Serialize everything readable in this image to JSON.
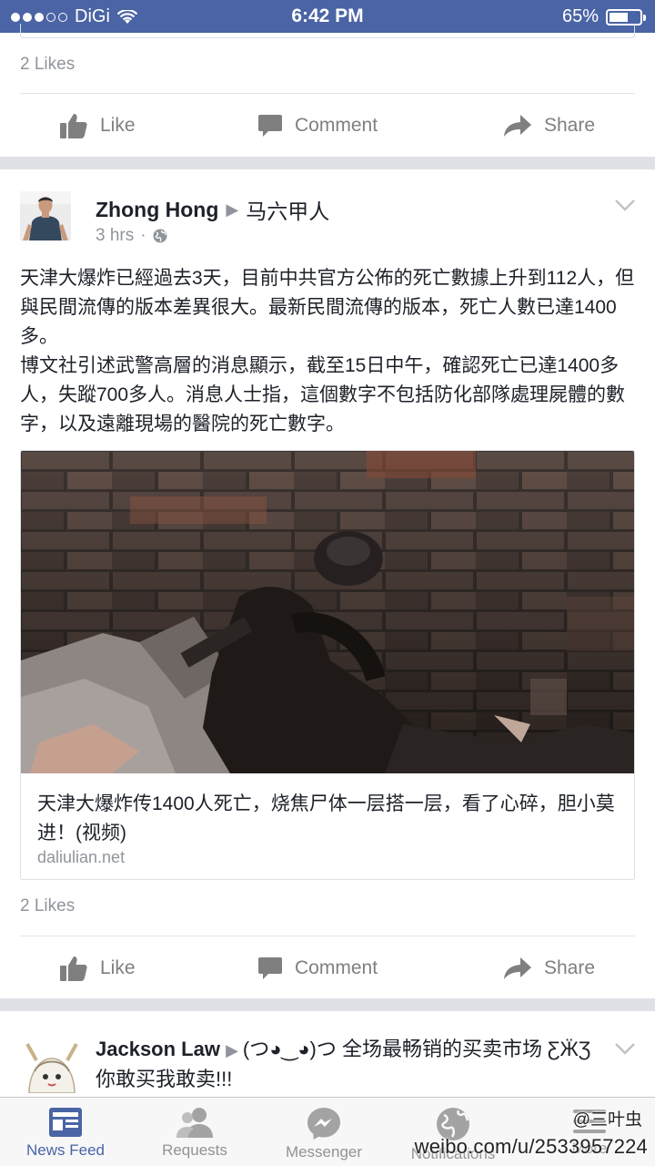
{
  "status_bar": {
    "carrier": "DiGi",
    "time": "6:42 PM",
    "battery": "65%",
    "battery_level": 0.65,
    "signal_bars": 3
  },
  "previous_post": {
    "likes": "2 Likes",
    "actions": {
      "like": "Like",
      "comment": "Comment",
      "share": "Share"
    }
  },
  "post": {
    "author": "Zhong Hong",
    "target": "马六甲人",
    "time": "3 hrs",
    "privacy_icon": "globe-icon",
    "text": "天津大爆炸已經過去3天，目前中共官方公佈的死亡數據上升到112人，但與民間流傳的版本差異很大。最新民間流傳的版本，死亡人數已達1400多。\n博文社引述武警高層的消息顯示，截至15日中午，確認死亡已達1400多人，失蹤700多人。消息人士指，這個數字不包括防化部隊處理屍體的數字，以及遠離現場的醫院的死亡數字。",
    "link": {
      "title": "天津大爆炸传1400人死亡，烧焦尸体一层搭一层，看了心碎，胆小莫进！(视频)",
      "domain": "daliulian.net"
    },
    "likes": "2 Likes",
    "actions": {
      "like": "Like",
      "comment": "Comment",
      "share": "Share"
    }
  },
  "next_post": {
    "author": "Jackson Law",
    "target": "(つ◕‿◕)つ 全场最畅销的买卖市场 ƸӜƷ 你敢买我敢卖!!!"
  },
  "tab_bar": {
    "tabs": [
      {
        "label": "News Feed",
        "icon": "news-feed-icon",
        "active": true
      },
      {
        "label": "Requests",
        "icon": "friends-icon",
        "active": false
      },
      {
        "label": "Messenger",
        "icon": "messenger-icon",
        "active": false
      },
      {
        "label": "Notifications",
        "icon": "globe-icon",
        "active": false
      },
      {
        "label": "More",
        "icon": "menu-icon",
        "active": false
      }
    ]
  },
  "watermark": {
    "handle": "@三叶虫",
    "url": "weibo.com/u/2533957224"
  },
  "colors": {
    "brand": "#4a64a5",
    "active_tab": "#4a64a5",
    "muted_text": "#90949c",
    "background": "#dfe1e6"
  }
}
